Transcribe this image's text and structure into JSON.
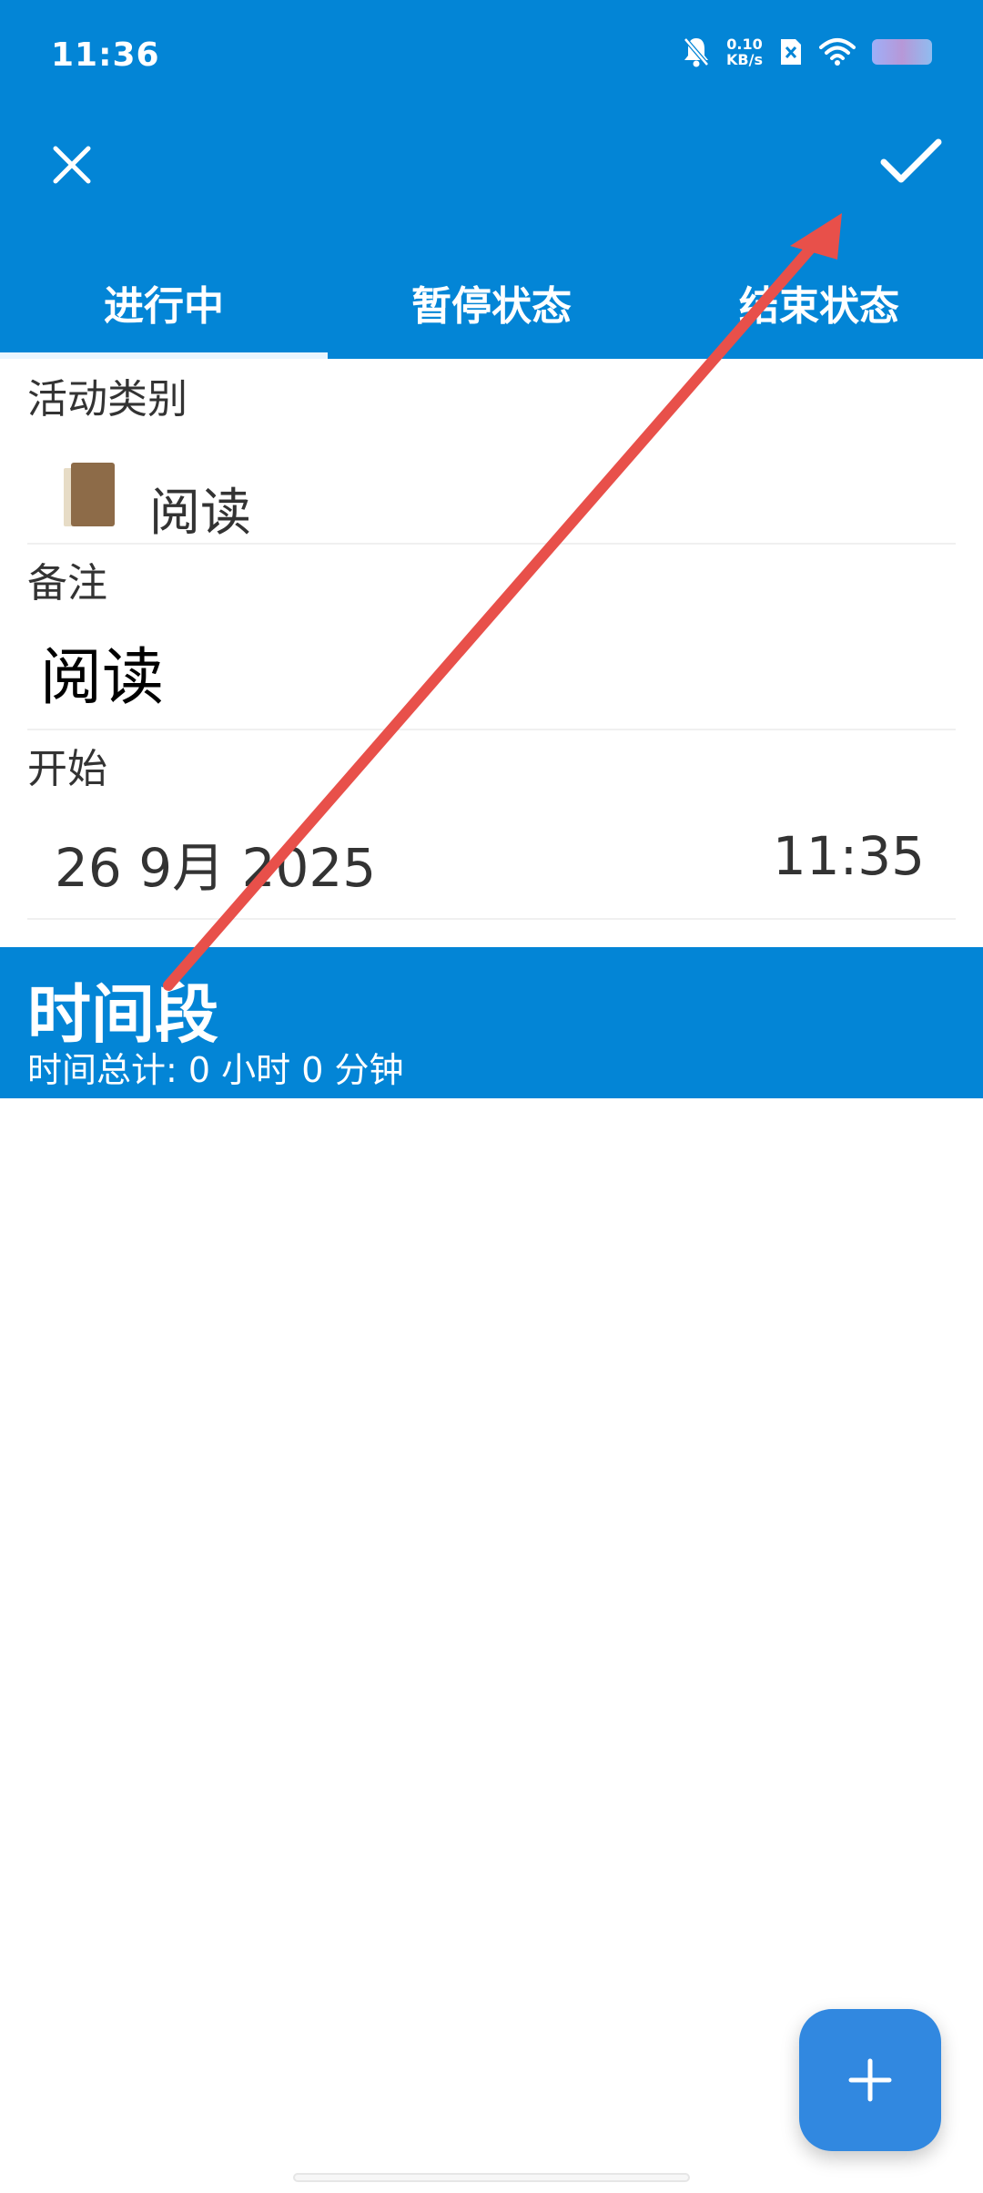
{
  "status_bar": {
    "time": "11:36",
    "net_speed_value": "0.10",
    "net_speed_unit": "KB/s"
  },
  "toolbar": {
    "close_icon": "close-icon",
    "confirm_icon": "check-icon"
  },
  "tabs": [
    {
      "label": "进行中",
      "active": true
    },
    {
      "label": "暂停状态",
      "active": false
    },
    {
      "label": "结束状态",
      "active": false
    }
  ],
  "category": {
    "label": "活动类别",
    "value": "阅读",
    "icon": "book-icon"
  },
  "note": {
    "label": "备注",
    "value": "阅读"
  },
  "start": {
    "label": "开始",
    "date": "26 9月 2025",
    "time": "11:35"
  },
  "period": {
    "title": "时间段",
    "summary": "时间总计: 0 小时 0 分钟"
  },
  "fab": {
    "icon": "plus-icon"
  },
  "colors": {
    "primary": "#0385d6",
    "fab": "#3188e0",
    "annotation": "#e8504a"
  }
}
